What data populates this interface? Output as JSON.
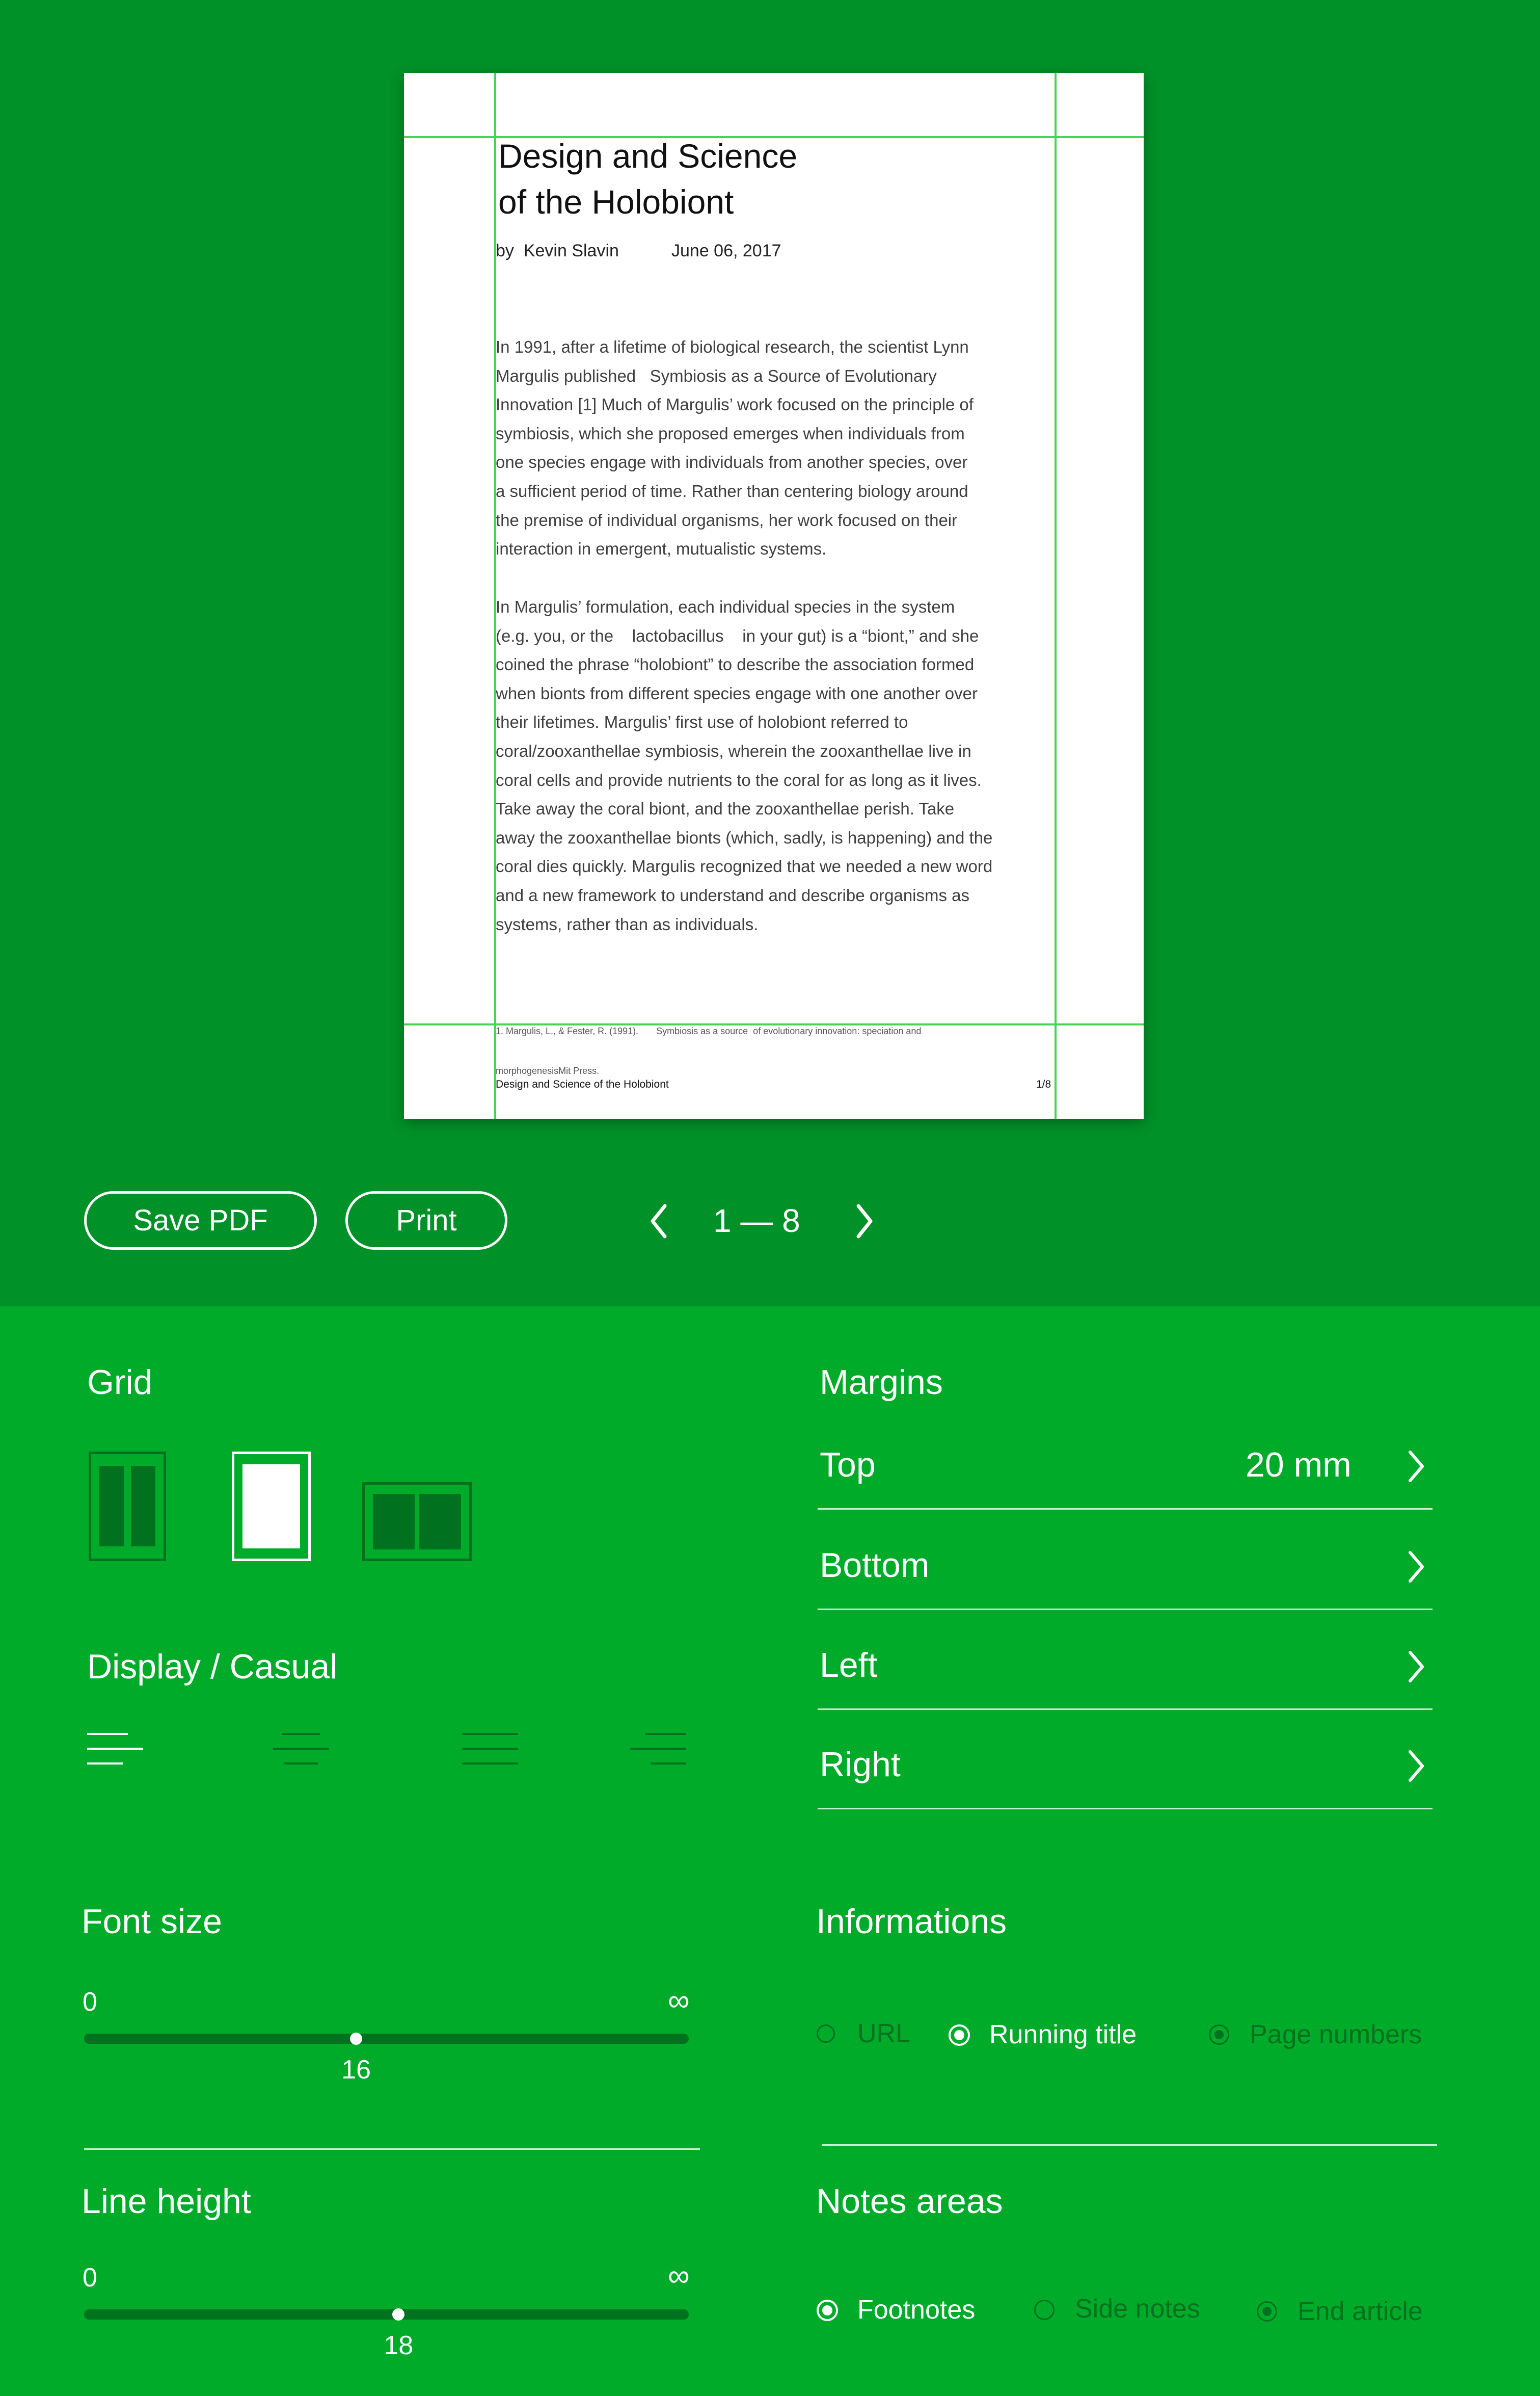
{
  "preview": {
    "title_line1": "Design and Science",
    "title_line2": "of the Holobiont",
    "byline_by": "by",
    "byline_author": "Kevin Slavin",
    "byline_date": "June 06, 2017",
    "para1": [
      "In 1991, after a lifetime of biological research, the scientist Lynn",
      "Margulis published   Symbiosis as a Source of Evolutionary",
      "Innovation [1] Much of Margulis’ work focused on the principle of",
      "symbiosis, which she proposed emerges when individuals from",
      "one species engage with individuals from another species, over",
      "a sufficient period of time. Rather than centering biology around",
      "the premise of individual organisms, her work focused on their",
      "interaction in emergent, mutualistic systems."
    ],
    "para2": [
      "In Margulis’ formulation, each individual species in the system",
      "(e.g. you, or the    lactobacillus    in your gut) is a “biont,” and she",
      "coined the phrase “holobiont” to describe the association formed",
      "when bionts from different species engage with one another over",
      "their lifetimes. Margulis’ first use of holobiont referred to",
      "coral/zooxanthellae symbiosis, wherein the zooxanthellae live in",
      "coral cells and provide nutrients to the coral for as long as it lives.",
      "Take away the coral biont, and the zooxanthellae perish. Take",
      "away the zooxanthellae bionts (which, sadly, is happening) and the",
      "coral dies quickly. Margulis recognized that we needed a new word",
      "and a new framework to understand and describe organisms as",
      "systems, rather than as individuals."
    ],
    "footnote_line1": "1. Margulis, L., & Fester, R. (1991).       Symbiosis as a source  of evolutionary innovation: speciation and",
    "footnote_line2": "morphogenesisMit Press.",
    "running_title": "Design and Science of the Holobiont",
    "page_number": "1/8"
  },
  "toolbar": {
    "save_pdf": "Save PDF",
    "print": "Print",
    "pages": "1 — 8"
  },
  "settings": {
    "grid_label": "Grid",
    "display_label": "Display / Casual",
    "font_size": {
      "label": "Font size",
      "min": "0",
      "max": "∞",
      "value": "16",
      "fraction": 0.45
    },
    "line_height": {
      "label": "Line height",
      "min": "0",
      "max": "∞",
      "value": "18",
      "fraction": 0.52
    },
    "margins": {
      "label": "Margins",
      "items": [
        {
          "label": "Top",
          "value": "20 mm"
        },
        {
          "label": "Bottom",
          "value": ""
        },
        {
          "label": "Left",
          "value": ""
        },
        {
          "label": "Right",
          "value": ""
        }
      ]
    },
    "informations": {
      "label": "Informations",
      "options": [
        {
          "label": "URL",
          "selected": false
        },
        {
          "label": "Running title",
          "selected": true
        },
        {
          "label": "Page numbers",
          "selected": false
        }
      ]
    },
    "notes": {
      "label": "Notes areas",
      "options": [
        {
          "label": "Footnotes",
          "selected": true
        },
        {
          "label": "Side notes",
          "selected": false
        },
        {
          "label": "End article",
          "selected": false
        }
      ]
    }
  },
  "colors": {
    "top_bg": "#009128",
    "panel_bg": "#00AB2A",
    "dark_green": "#00711e",
    "guide_line": "#47d35a"
  }
}
